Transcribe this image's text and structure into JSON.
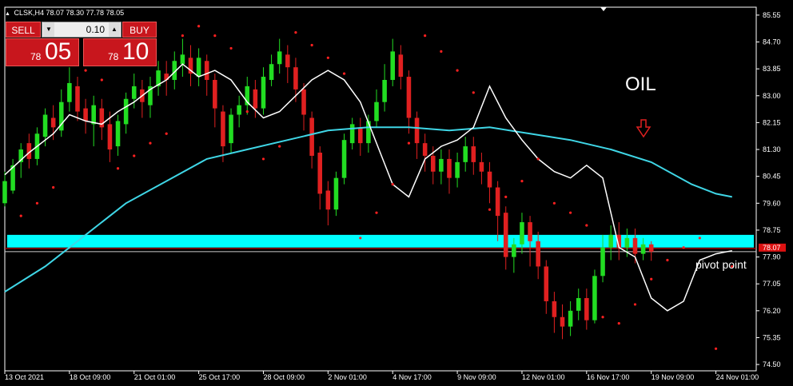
{
  "header": {
    "symbol": "CLSK,H4",
    "ohlc": "78.07 78.30 77.78 78.05"
  },
  "ticket": {
    "sell_label": "SELL",
    "buy_label": "BUY",
    "lot": "0.10",
    "sell_small": "78",
    "sell_big": "05",
    "buy_small": "78",
    "buy_big": "10"
  },
  "annotations": {
    "title": "OIL",
    "pivot": "pivot point",
    "price_tag": "78.07"
  },
  "chart_data": {
    "type": "candlestick",
    "title": "OIL",
    "symbol": "CLSK,H4",
    "ylim": [
      74.5,
      86.0
    ],
    "y_ticks": [
      "85.55",
      "84.70",
      "83.85",
      "83.00",
      "82.15",
      "81.30",
      "80.45",
      "79.60",
      "78.75",
      "77.90",
      "77.05",
      "76.20",
      "75.35",
      "74.50"
    ],
    "x_ticks": [
      "13 Oct 2021",
      "18 Oct 09:00",
      "21 Oct 01:00",
      "25 Oct 17:00",
      "28 Oct 09:00",
      "2 Nov 01:00",
      "4 Nov 17:00",
      "9 Nov 09:00",
      "12 Nov 01:00",
      "16 Nov 17:00",
      "19 Nov 09:00",
      "24 Nov 01:00"
    ],
    "x_range": [
      0,
      92
    ],
    "x_tick_pos": [
      0,
      8,
      16,
      24,
      32,
      40,
      48,
      56,
      64,
      72,
      80,
      88
    ],
    "current_price": 78.07,
    "pivot_line": 78.07,
    "zone": {
      "low": 78.2,
      "high": 78.6,
      "color": "#00ffff"
    },
    "ma_fast": [
      [
        0,
        80.5
      ],
      [
        3,
        81.2
      ],
      [
        6,
        81.8
      ],
      [
        8,
        82.4
      ],
      [
        10,
        82.2
      ],
      [
        12,
        82.1
      ],
      [
        14,
        82.5
      ],
      [
        16,
        82.8
      ],
      [
        18,
        83.2
      ],
      [
        20,
        83.5
      ],
      [
        22,
        84.0
      ],
      [
        24,
        83.6
      ],
      [
        26,
        83.8
      ],
      [
        28,
        83.5
      ],
      [
        30,
        82.8
      ],
      [
        32,
        82.3
      ],
      [
        34,
        82.5
      ],
      [
        36,
        83.0
      ],
      [
        38,
        83.5
      ],
      [
        40,
        83.8
      ],
      [
        42,
        83.5
      ],
      [
        44,
        82.8
      ],
      [
        46,
        81.5
      ],
      [
        48,
        80.2
      ],
      [
        50,
        79.8
      ],
      [
        52,
        81.0
      ],
      [
        54,
        81.4
      ],
      [
        56,
        81.6
      ],
      [
        58,
        82.0
      ],
      [
        60,
        83.3
      ],
      [
        62,
        82.3
      ],
      [
        64,
        81.6
      ],
      [
        66,
        81.0
      ],
      [
        68,
        80.6
      ],
      [
        70,
        80.4
      ],
      [
        72,
        80.8
      ],
      [
        74,
        80.4
      ],
      [
        76,
        78.2
      ],
      [
        78,
        77.9
      ],
      [
        80,
        76.6
      ],
      [
        82,
        76.2
      ],
      [
        84,
        76.5
      ],
      [
        86,
        77.8
      ],
      [
        88,
        78.0
      ],
      [
        90,
        78.1
      ]
    ],
    "ma_slow": [
      [
        0,
        76.8
      ],
      [
        5,
        77.6
      ],
      [
        10,
        78.6
      ],
      [
        15,
        79.6
      ],
      [
        20,
        80.3
      ],
      [
        25,
        81.0
      ],
      [
        30,
        81.3
      ],
      [
        35,
        81.6
      ],
      [
        40,
        81.9
      ],
      [
        45,
        82.0
      ],
      [
        50,
        82.0
      ],
      [
        55,
        81.9
      ],
      [
        60,
        82.0
      ],
      [
        65,
        81.8
      ],
      [
        70,
        81.6
      ],
      [
        75,
        81.3
      ],
      [
        80,
        80.9
      ],
      [
        85,
        80.2
      ],
      [
        88,
        79.9
      ],
      [
        90,
        79.8
      ]
    ],
    "candles": [
      [
        0,
        79.6,
        80.3,
        79.5,
        80.6
      ],
      [
        1,
        80.0,
        80.8,
        79.9,
        81.0
      ],
      [
        2,
        80.9,
        81.3,
        80.4,
        81.5
      ],
      [
        3,
        81.5,
        81.0,
        80.7,
        81.8
      ],
      [
        4,
        81.0,
        81.8,
        80.8,
        82.0
      ],
      [
        5,
        81.7,
        82.4,
        81.4,
        82.6
      ],
      [
        6,
        82.3,
        82.0,
        81.6,
        82.7
      ],
      [
        7,
        81.9,
        82.8,
        81.7,
        83.2
      ],
      [
        8,
        82.8,
        83.4,
        82.5,
        83.9
      ],
      [
        9,
        83.3,
        82.5,
        82.2,
        83.6
      ],
      [
        10,
        82.6,
        82.2,
        81.8,
        82.9
      ],
      [
        11,
        82.1,
        82.7,
        81.4,
        83.0
      ],
      [
        12,
        82.6,
        82.0,
        81.6,
        82.9
      ],
      [
        13,
        82.1,
        81.3,
        80.9,
        82.5
      ],
      [
        14,
        81.4,
        82.2,
        81.1,
        82.4
      ],
      [
        15,
        82.1,
        82.9,
        81.8,
        83.1
      ],
      [
        16,
        82.9,
        83.3,
        82.6,
        83.7
      ],
      [
        17,
        83.2,
        82.8,
        82.3,
        83.5
      ],
      [
        18,
        82.7,
        83.3,
        82.3,
        83.6
      ],
      [
        19,
        83.3,
        83.8,
        83.0,
        84.1
      ],
      [
        20,
        83.7,
        83.5,
        83.0,
        84.1
      ],
      [
        21,
        83.5,
        84.1,
        83.2,
        84.4
      ],
      [
        22,
        84.0,
        84.3,
        83.6,
        84.8
      ],
      [
        23,
        84.2,
        83.7,
        83.3,
        84.6
      ],
      [
        24,
        83.6,
        84.2,
        83.3,
        84.5
      ],
      [
        25,
        84.1,
        83.5,
        83.0,
        84.3
      ],
      [
        26,
        83.5,
        82.6,
        82.0,
        83.7
      ],
      [
        27,
        82.5,
        81.4,
        80.9,
        82.7
      ],
      [
        28,
        81.5,
        82.4,
        81.2,
        82.6
      ],
      [
        29,
        82.4,
        82.7,
        82.0,
        83.0
      ],
      [
        30,
        82.7,
        83.3,
        82.4,
        83.6
      ],
      [
        31,
        83.2,
        82.6,
        82.3,
        83.5
      ],
      [
        32,
        82.6,
        83.6,
        82.4,
        83.9
      ],
      [
        33,
        83.5,
        84.0,
        83.3,
        84.3
      ],
      [
        34,
        84.0,
        84.4,
        83.7,
        84.8
      ],
      [
        35,
        84.3,
        83.9,
        83.4,
        84.6
      ],
      [
        36,
        83.9,
        83.2,
        82.8,
        84.2
      ],
      [
        37,
        83.2,
        82.4,
        81.9,
        83.4
      ],
      [
        38,
        82.3,
        81.1,
        80.7,
        82.5
      ],
      [
        39,
        81.2,
        79.9,
        79.4,
        81.4
      ],
      [
        40,
        80.0,
        79.4,
        78.9,
        80.3
      ],
      [
        41,
        79.4,
        80.4,
        79.2,
        80.6
      ],
      [
        42,
        80.4,
        81.6,
        80.2,
        81.8
      ],
      [
        43,
        81.5,
        82.1,
        81.3,
        82.3
      ],
      [
        44,
        82.0,
        81.5,
        81.1,
        82.3
      ],
      [
        45,
        81.5,
        82.2,
        81.2,
        82.4
      ],
      [
        46,
        82.2,
        82.8,
        82.0,
        83.2
      ],
      [
        47,
        82.8,
        83.5,
        82.5,
        84.0
      ],
      [
        48,
        83.5,
        84.4,
        83.3,
        84.8
      ],
      [
        49,
        84.3,
        83.6,
        83.2,
        84.6
      ],
      [
        50,
        83.6,
        82.3,
        81.8,
        83.8
      ],
      [
        51,
        82.3,
        81.5,
        81.0,
        82.5
      ],
      [
        52,
        81.5,
        81.1,
        80.6,
        81.8
      ],
      [
        53,
        81.1,
        80.6,
        80.2,
        81.4
      ],
      [
        54,
        80.6,
        81.0,
        80.2,
        81.3
      ],
      [
        55,
        81.0,
        80.4,
        79.9,
        81.3
      ],
      [
        56,
        80.4,
        80.9,
        80.1,
        81.2
      ],
      [
        57,
        80.9,
        81.4,
        80.6,
        81.7
      ],
      [
        58,
        81.4,
        80.9,
        80.5,
        81.7
      ],
      [
        59,
        80.9,
        80.6,
        80.2,
        81.2
      ],
      [
        60,
        80.6,
        80.1,
        79.6,
        80.9
      ],
      [
        61,
        80.1,
        79.2,
        78.4,
        80.3
      ],
      [
        62,
        79.3,
        77.9,
        77.5,
        79.5
      ],
      [
        63,
        77.9,
        78.3,
        77.4,
        78.5
      ],
      [
        64,
        78.3,
        79.0,
        78.0,
        79.3
      ],
      [
        65,
        79.0,
        78.4,
        77.6,
        79.2
      ],
      [
        66,
        78.4,
        77.6,
        77.2,
        78.7
      ],
      [
        67,
        77.6,
        76.5,
        76.1,
        77.8
      ],
      [
        68,
        76.5,
        76.0,
        75.5,
        76.8
      ],
      [
        69,
        76.0,
        75.7,
        75.3,
        76.4
      ],
      [
        70,
        75.7,
        76.2,
        75.4,
        76.5
      ],
      [
        71,
        76.2,
        76.6,
        75.9,
        76.9
      ],
      [
        72,
        76.6,
        75.9,
        75.6,
        76.9
      ],
      [
        73,
        75.9,
        77.3,
        75.8,
        77.5
      ],
      [
        74,
        77.3,
        78.2,
        77.1,
        78.6
      ],
      [
        75,
        78.2,
        78.6,
        77.8,
        78.9
      ],
      [
        76,
        78.6,
        78.2,
        77.8,
        79.0
      ],
      [
        77,
        78.2,
        78.5,
        77.9,
        78.8
      ],
      [
        78,
        78.5,
        78.0,
        77.7,
        78.8
      ],
      [
        79,
        78.0,
        78.3,
        77.8,
        78.5
      ],
      [
        80,
        78.3,
        78.07,
        77.78,
        78.4
      ]
    ],
    "sar": [
      [
        2,
        79.2
      ],
      [
        4,
        79.6
      ],
      [
        6,
        80.1
      ],
      [
        8,
        84.1
      ],
      [
        10,
        83.8
      ],
      [
        12,
        83.5
      ],
      [
        14,
        80.7
      ],
      [
        16,
        81.1
      ],
      [
        18,
        81.5
      ],
      [
        20,
        81.8
      ],
      [
        22,
        84.9
      ],
      [
        24,
        85.2
      ],
      [
        26,
        84.9
      ],
      [
        28,
        84.5
      ],
      [
        30,
        82.5
      ],
      [
        32,
        81.0
      ],
      [
        34,
        81.4
      ],
      [
        36,
        85.0
      ],
      [
        38,
        84.6
      ],
      [
        40,
        84.2
      ],
      [
        42,
        83.7
      ],
      [
        44,
        78.5
      ],
      [
        46,
        79.3
      ],
      [
        48,
        80.2
      ],
      [
        50,
        81.5
      ],
      [
        52,
        84.9
      ],
      [
        54,
        84.4
      ],
      [
        56,
        83.8
      ],
      [
        58,
        83.1
      ],
      [
        60,
        79.4
      ],
      [
        62,
        79.8
      ],
      [
        64,
        80.3
      ],
      [
        66,
        81.0
      ],
      [
        68,
        79.6
      ],
      [
        70,
        79.3
      ],
      [
        72,
        78.9
      ],
      [
        74,
        76.0
      ],
      [
        76,
        75.8
      ],
      [
        78,
        76.4
      ],
      [
        80,
        77.2
      ],
      [
        82,
        77.8
      ],
      [
        84,
        78.2
      ],
      [
        86,
        78.5
      ],
      [
        88,
        75.0
      ],
      [
        90,
        77.6
      ]
    ]
  }
}
